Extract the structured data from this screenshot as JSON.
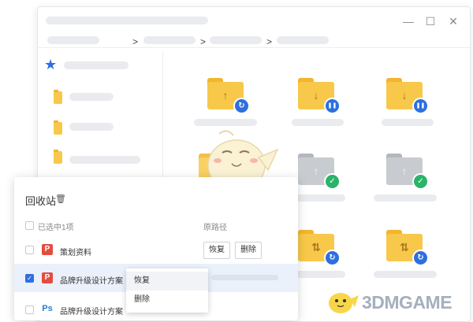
{
  "window": {
    "controls": {
      "minimize": "—",
      "maximize": "☐",
      "close": "✕"
    },
    "breadcrumb_sep": ">"
  },
  "recycle_bin": {
    "title": "回收站",
    "header": {
      "selected": "已选中1项",
      "orig_path": "原路径"
    },
    "rows": [
      {
        "name": "策划资料",
        "icon": "ppt-icon",
        "checked": false,
        "restore": "恢复",
        "delete": "删除"
      },
      {
        "name": "品牌升级设计方案",
        "icon": "ppt-icon",
        "checked": true
      },
      {
        "name": "品牌升级设计方案",
        "icon": "ps-icon",
        "checked": false
      }
    ]
  },
  "context_menu": {
    "items": [
      "恢复",
      "删除"
    ]
  },
  "watermark": {
    "text": "3DMGAME"
  },
  "colors": {
    "accent": "#2d6fe0",
    "folder_yellow": "#f7c84a",
    "folder_gray": "#c8ccd1",
    "success": "#2bb36a",
    "ppt_red": "#e34d3f"
  },
  "icons": {
    "upload": "↑",
    "download": "↓",
    "transfer": "⇅",
    "sync": "↻",
    "pause": "❚❚",
    "done": "✓",
    "star": "★",
    "trash": "🗑"
  }
}
